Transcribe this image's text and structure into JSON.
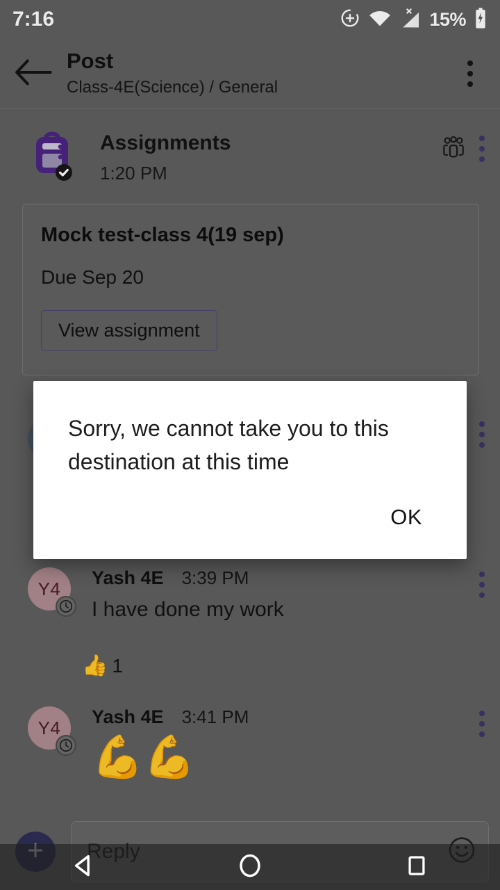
{
  "status_bar": {
    "time": "7:16",
    "battery_percent": "15%",
    "icons": [
      "dnd-plus-icon",
      "wifi-icon",
      "cellular-no-sim-icon",
      "battery-charging-icon"
    ]
  },
  "app_bar": {
    "back_icon": "back-arrow-icon",
    "title": "Post",
    "subtitle": "Class-4E(Science) / General",
    "overflow_icon": "more-vertical-icon"
  },
  "post": {
    "app_icon": "assignments-backpack-icon",
    "app_name": "Assignments",
    "time": "1:20 PM",
    "people_icon": "people-group-icon",
    "overflow_icon": "more-vertical-icon",
    "card": {
      "title": "Mock test-class 4(19 sep)",
      "due": "Due Sep 20",
      "button_label": "View assignment"
    }
  },
  "messages": [
    {
      "avatar_initials": "Y4",
      "author": "Yash 4E",
      "time": "3:39 PM",
      "text": "I have done my work",
      "status_icon": "clock-pending-icon",
      "overflow_icon": "more-vertical-icon",
      "reaction": {
        "emoji": "👍",
        "count": "1"
      }
    },
    {
      "avatar_initials": "Y4",
      "author": "Yash 4E",
      "time": "3:41 PM",
      "text": "💪💪",
      "status_icon": "clock-pending-icon",
      "overflow_icon": "more-vertical-icon"
    }
  ],
  "reply_bar": {
    "add_icon": "plus-icon",
    "placeholder": "Reply",
    "emoji_icon": "smiley-face-icon"
  },
  "dialog": {
    "message": "Sorry, we cannot take you to this destination at this time",
    "ok_label": "OK"
  },
  "nav_bar": {
    "back_icon": "nav-back-triangle-icon",
    "home_icon": "nav-home-circle-icon",
    "recents_icon": "nav-recents-square-icon"
  },
  "colors": {
    "background": "#606060",
    "accent_purple": "#3b3668",
    "assignments_purple": "#4b2583",
    "avatar": "#b08c92",
    "dialog_bg": "#ffffff"
  }
}
